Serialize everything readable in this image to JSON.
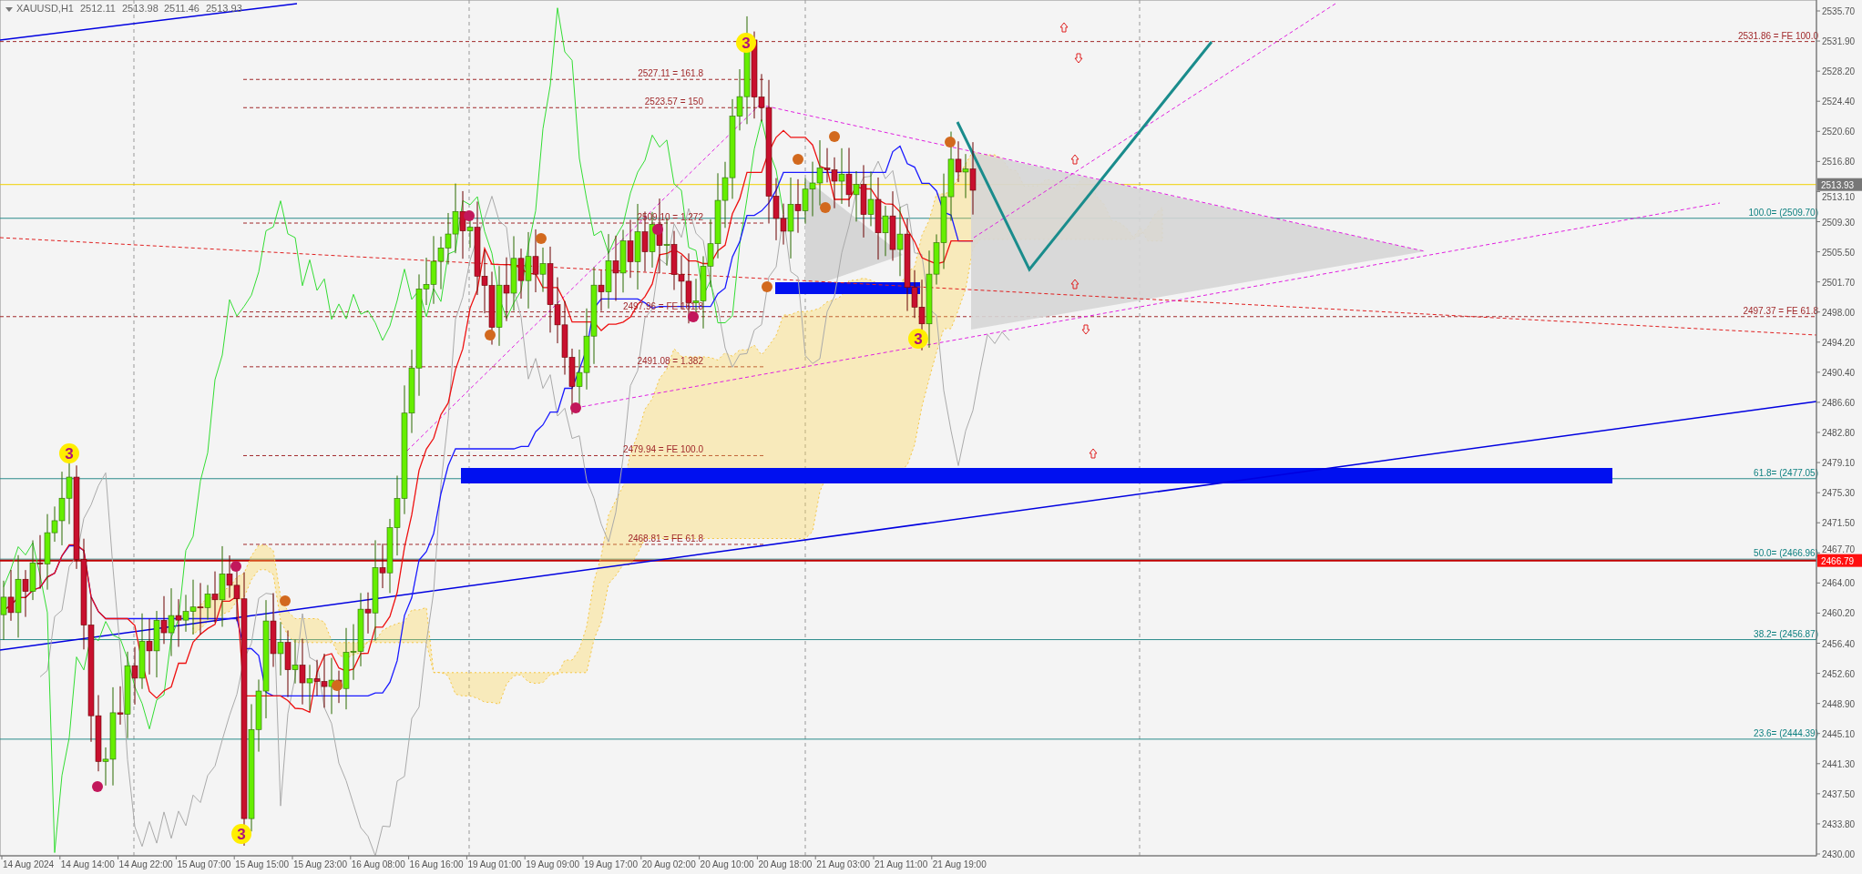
{
  "header": {
    "symbol": "XAUUSD,H1",
    "quotes": [
      "2512.11",
      "2513.98",
      "2511.46",
      "2513.93"
    ]
  },
  "price_axis": {
    "labels": [
      "2535.70",
      "2531.90",
      "2528.20",
      "2524.40",
      "2520.60",
      "2516.80",
      "2513.10",
      "2509.30",
      "2505.50",
      "2501.70",
      "2498.00",
      "2494.20",
      "2490.40",
      "2486.60",
      "2482.80",
      "2479.10",
      "2475.30",
      "2471.50",
      "2467.70",
      "2464.00",
      "2460.20",
      "2456.40",
      "2452.60",
      "2448.90",
      "2445.10",
      "2441.30",
      "2437.50",
      "2433.80",
      "2430.00"
    ],
    "bid_price": "2513.93",
    "line_price": "2466.79"
  },
  "time_axis": {
    "labels": [
      "14 Aug 2024",
      "14 Aug 14:00",
      "14 Aug 22:00",
      "15 Aug 07:00",
      "15 Aug 15:00",
      "15 Aug 23:00",
      "16 Aug 08:00",
      "16 Aug 16:00",
      "19 Aug 01:00",
      "19 Aug 09:00",
      "19 Aug 17:00",
      "20 Aug 02:00",
      "20 Aug 10:00",
      "20 Aug 18:00",
      "21 Aug 03:00",
      "21 Aug 11:00",
      "21 Aug 19:00"
    ]
  },
  "fibo_levels": [
    {
      "label": "100.0= (2509.70)"
    },
    {
      "label": "61.8= (2477.05)"
    },
    {
      "label": "50.0= (2466.96)"
    },
    {
      "label": "38.2= (2456.87)"
    },
    {
      "label": "23.6= (2444.39)"
    }
  ],
  "expansion_levels": [
    {
      "label": "2531.86 = FE 100.0"
    },
    {
      "label": "2497.37 = FE 61.8"
    }
  ],
  "projection_labels": [
    {
      "text": "2527.11 = 161.8"
    },
    {
      "text": "2523.57 = 150"
    },
    {
      "text": "2509.10 = 1.272"
    },
    {
      "text": "2497.96 = FE 161.8"
    },
    {
      "text": "2491.08 = 1.382"
    },
    {
      "text": "2479.94 = FE 100.0"
    },
    {
      "text": "2468.81 = FE 61.8"
    }
  ],
  "wave_markers": [
    {
      "text": "3"
    },
    {
      "text": "3"
    },
    {
      "text": "3"
    },
    {
      "text": "3"
    }
  ]
}
